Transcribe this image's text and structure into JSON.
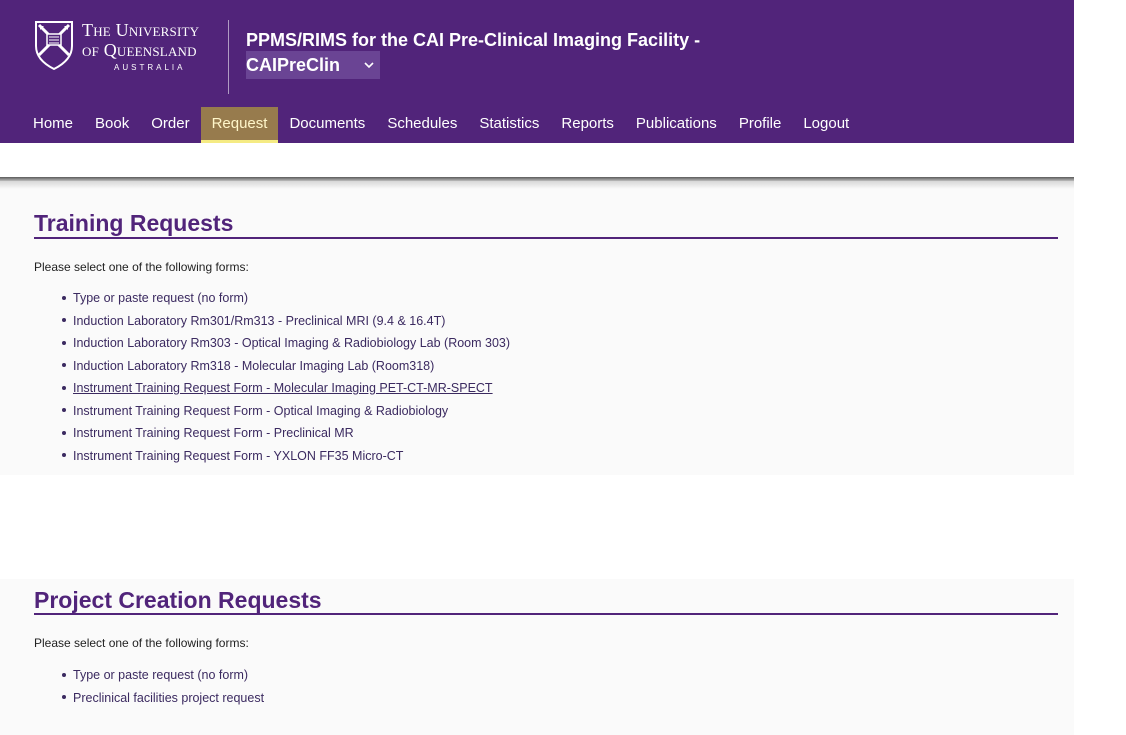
{
  "logo": {
    "line1": "The University",
    "line2": "of Queensland",
    "line3": "AUSTRALIA"
  },
  "facility": {
    "title": "PPMS/RIMS for the CAI Pre-Clinical Imaging Facility -",
    "selected": "CAIPreClin"
  },
  "nav": {
    "items": [
      {
        "label": "Home"
      },
      {
        "label": "Book"
      },
      {
        "label": "Order"
      },
      {
        "label": "Request"
      },
      {
        "label": "Documents"
      },
      {
        "label": "Schedules"
      },
      {
        "label": "Statistics"
      },
      {
        "label": "Reports"
      },
      {
        "label": "Publications"
      },
      {
        "label": "Profile"
      },
      {
        "label": "Logout"
      }
    ],
    "active": "Request"
  },
  "training": {
    "title": "Training Requests",
    "intro": "Please select one of the following forms:",
    "forms": [
      "Type or paste request (no form)",
      "Induction Laboratory Rm301/Rm313 - Preclinical MRI (9.4 & 16.4T)",
      "Induction Laboratory Rm303 - Optical Imaging & Radiobiology Lab (Room 303)",
      "Induction Laboratory Rm318 - Molecular Imaging Lab (Room318)",
      "Instrument Training Request Form - Molecular Imaging PET-CT-MR-SPECT",
      "Instrument Training Request Form - Optical Imaging & Radiobiology",
      "Instrument Training Request Form - Preclinical MR",
      "Instrument Training Request Form - YXLON FF35 Micro-CT"
    ]
  },
  "project": {
    "title": "Project Creation Requests",
    "intro": "Please select one of the following forms:",
    "forms": [
      "Type or paste request (no form)",
      "Preclinical facilities project request"
    ]
  },
  "colors": {
    "brand_purple": "#51247a",
    "active_tab_bg": "#977b4d",
    "active_tab_underline": "#f5eb83",
    "link": "#3b2a60"
  }
}
